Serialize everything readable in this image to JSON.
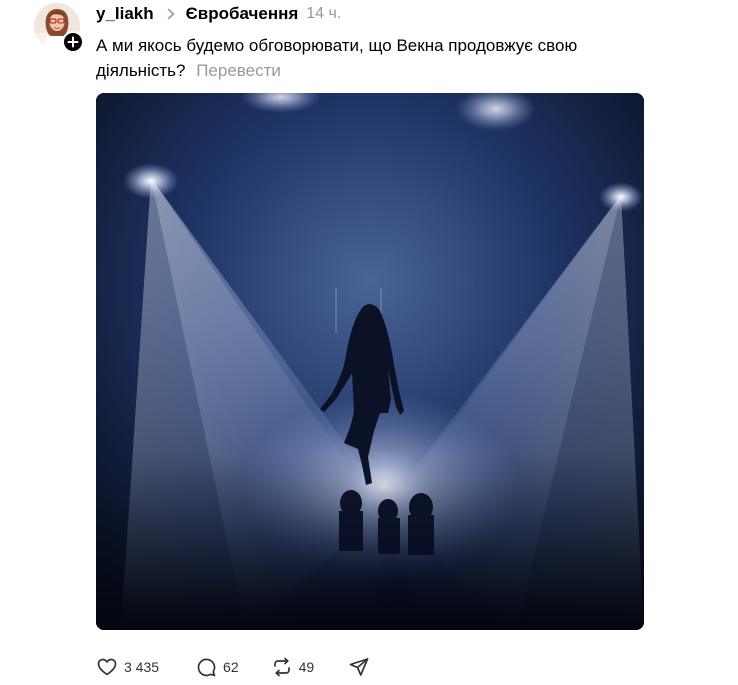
{
  "post": {
    "author": "y_liakh",
    "topic": "Євробачення",
    "time": "14 ч.",
    "text": "А ми якось будемо обговорювати, що Векна продовжує свою діяльність?",
    "translate_label": "Перевести"
  },
  "actions": {
    "likes": "3 435",
    "comments": "62",
    "reposts": "49"
  },
  "icons": {
    "like": "heart-icon",
    "comment": "comment-icon",
    "repost": "repost-icon",
    "share": "share-icon",
    "follow": "plus-icon",
    "separator": "chevron-right-icon"
  }
}
